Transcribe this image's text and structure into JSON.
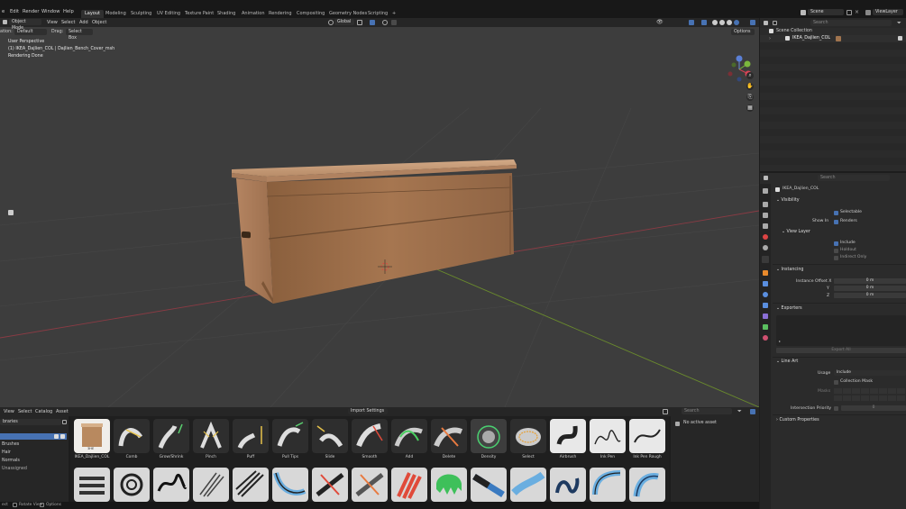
{
  "topbar": {
    "menus": [
      "e",
      "Edit",
      "Render",
      "Window",
      "Help"
    ],
    "workspaces": [
      "Layout",
      "Modeling",
      "Sculpting",
      "UV Editing",
      "Texture Paint",
      "Shading",
      "Animation",
      "Rendering",
      "Compositing",
      "Geometry Nodes",
      "Scripting"
    ],
    "active_workspace": "Layout",
    "add_tab": "+",
    "scene_label": "Scene",
    "viewlayer_label": "ViewLayer"
  },
  "viewport_header": {
    "mode": "Object Mode",
    "menus": [
      "View",
      "Select",
      "Add",
      "Object"
    ],
    "orientation": "Global",
    "options": "Options"
  },
  "tool_header": {
    "orientation_label": "ation:",
    "orientation_value": "Default",
    "drag_label": "Drag:",
    "drag_value": "Select Box"
  },
  "viewport_overlay": {
    "line1": "User Perspective",
    "line2": "(1) IKEA_Dajlien_COL | Dajlien_Bench_Cover_msh",
    "line3": "Rendering Done"
  },
  "gizmo": {
    "x": "X",
    "y": "Y",
    "z": "Z"
  },
  "outliner": {
    "search_placeholder": "Search",
    "root": "Scene Collection",
    "child": "IKEA_Dajlien_COL"
  },
  "properties": {
    "search_placeholder": "Search",
    "object_name": "IKEA_Dajlien_COL",
    "visibility": "Visibility",
    "selectable": "Selectable",
    "show_in": "Show In",
    "renders": "Renders",
    "view_layer": "View Layer",
    "include": "Include",
    "holdout": "Holdout",
    "indirect_only": "Indirect Only",
    "instancing": "Instancing",
    "instance_offset_x": "Instance Offset X",
    "y": "Y",
    "z": "Z",
    "offset_x_val": "0 m",
    "offset_y_val": "0 m",
    "offset_z_val": "0 m",
    "exporters": "Exporters",
    "export_all": "Export All",
    "line_art": "Line Art",
    "usage": "Usage",
    "usage_value": "Include",
    "collection_mask": "Collection Mask",
    "masks": "Masks",
    "intersection_priority": "Intersection Priority",
    "intersection_value": "0",
    "custom_properties": "Custom Properties"
  },
  "asset_browser": {
    "menus": [
      "View",
      "Select",
      "Catalog",
      "Asset"
    ],
    "import_settings": "Import Settings",
    "search_placeholder": "Search",
    "libraries_label": "braries",
    "catalogs": [
      "",
      "Brushes",
      "Hair",
      "Normals",
      "Unassigned"
    ],
    "no_active_asset": "No active asset",
    "row1": [
      "IKEA_Dajlien_COL",
      "Comb",
      "Grow/Shrink",
      "Pinch",
      "Puff",
      "Pull Tips",
      "Slide",
      "Smooth",
      "Add",
      "Delete",
      "Density",
      "Select",
      "Airbrush",
      "Ink Pen",
      "Ink Pen Rough"
    ],
    "thumb_badge": "3HE"
  },
  "statusbar": {
    "item1": "ect",
    "item2": "Rotate View",
    "item3": "Options"
  },
  "colors": {
    "accent": "#4772b3",
    "active_tile": "#3d3d3d",
    "wood": "#b07f57"
  }
}
